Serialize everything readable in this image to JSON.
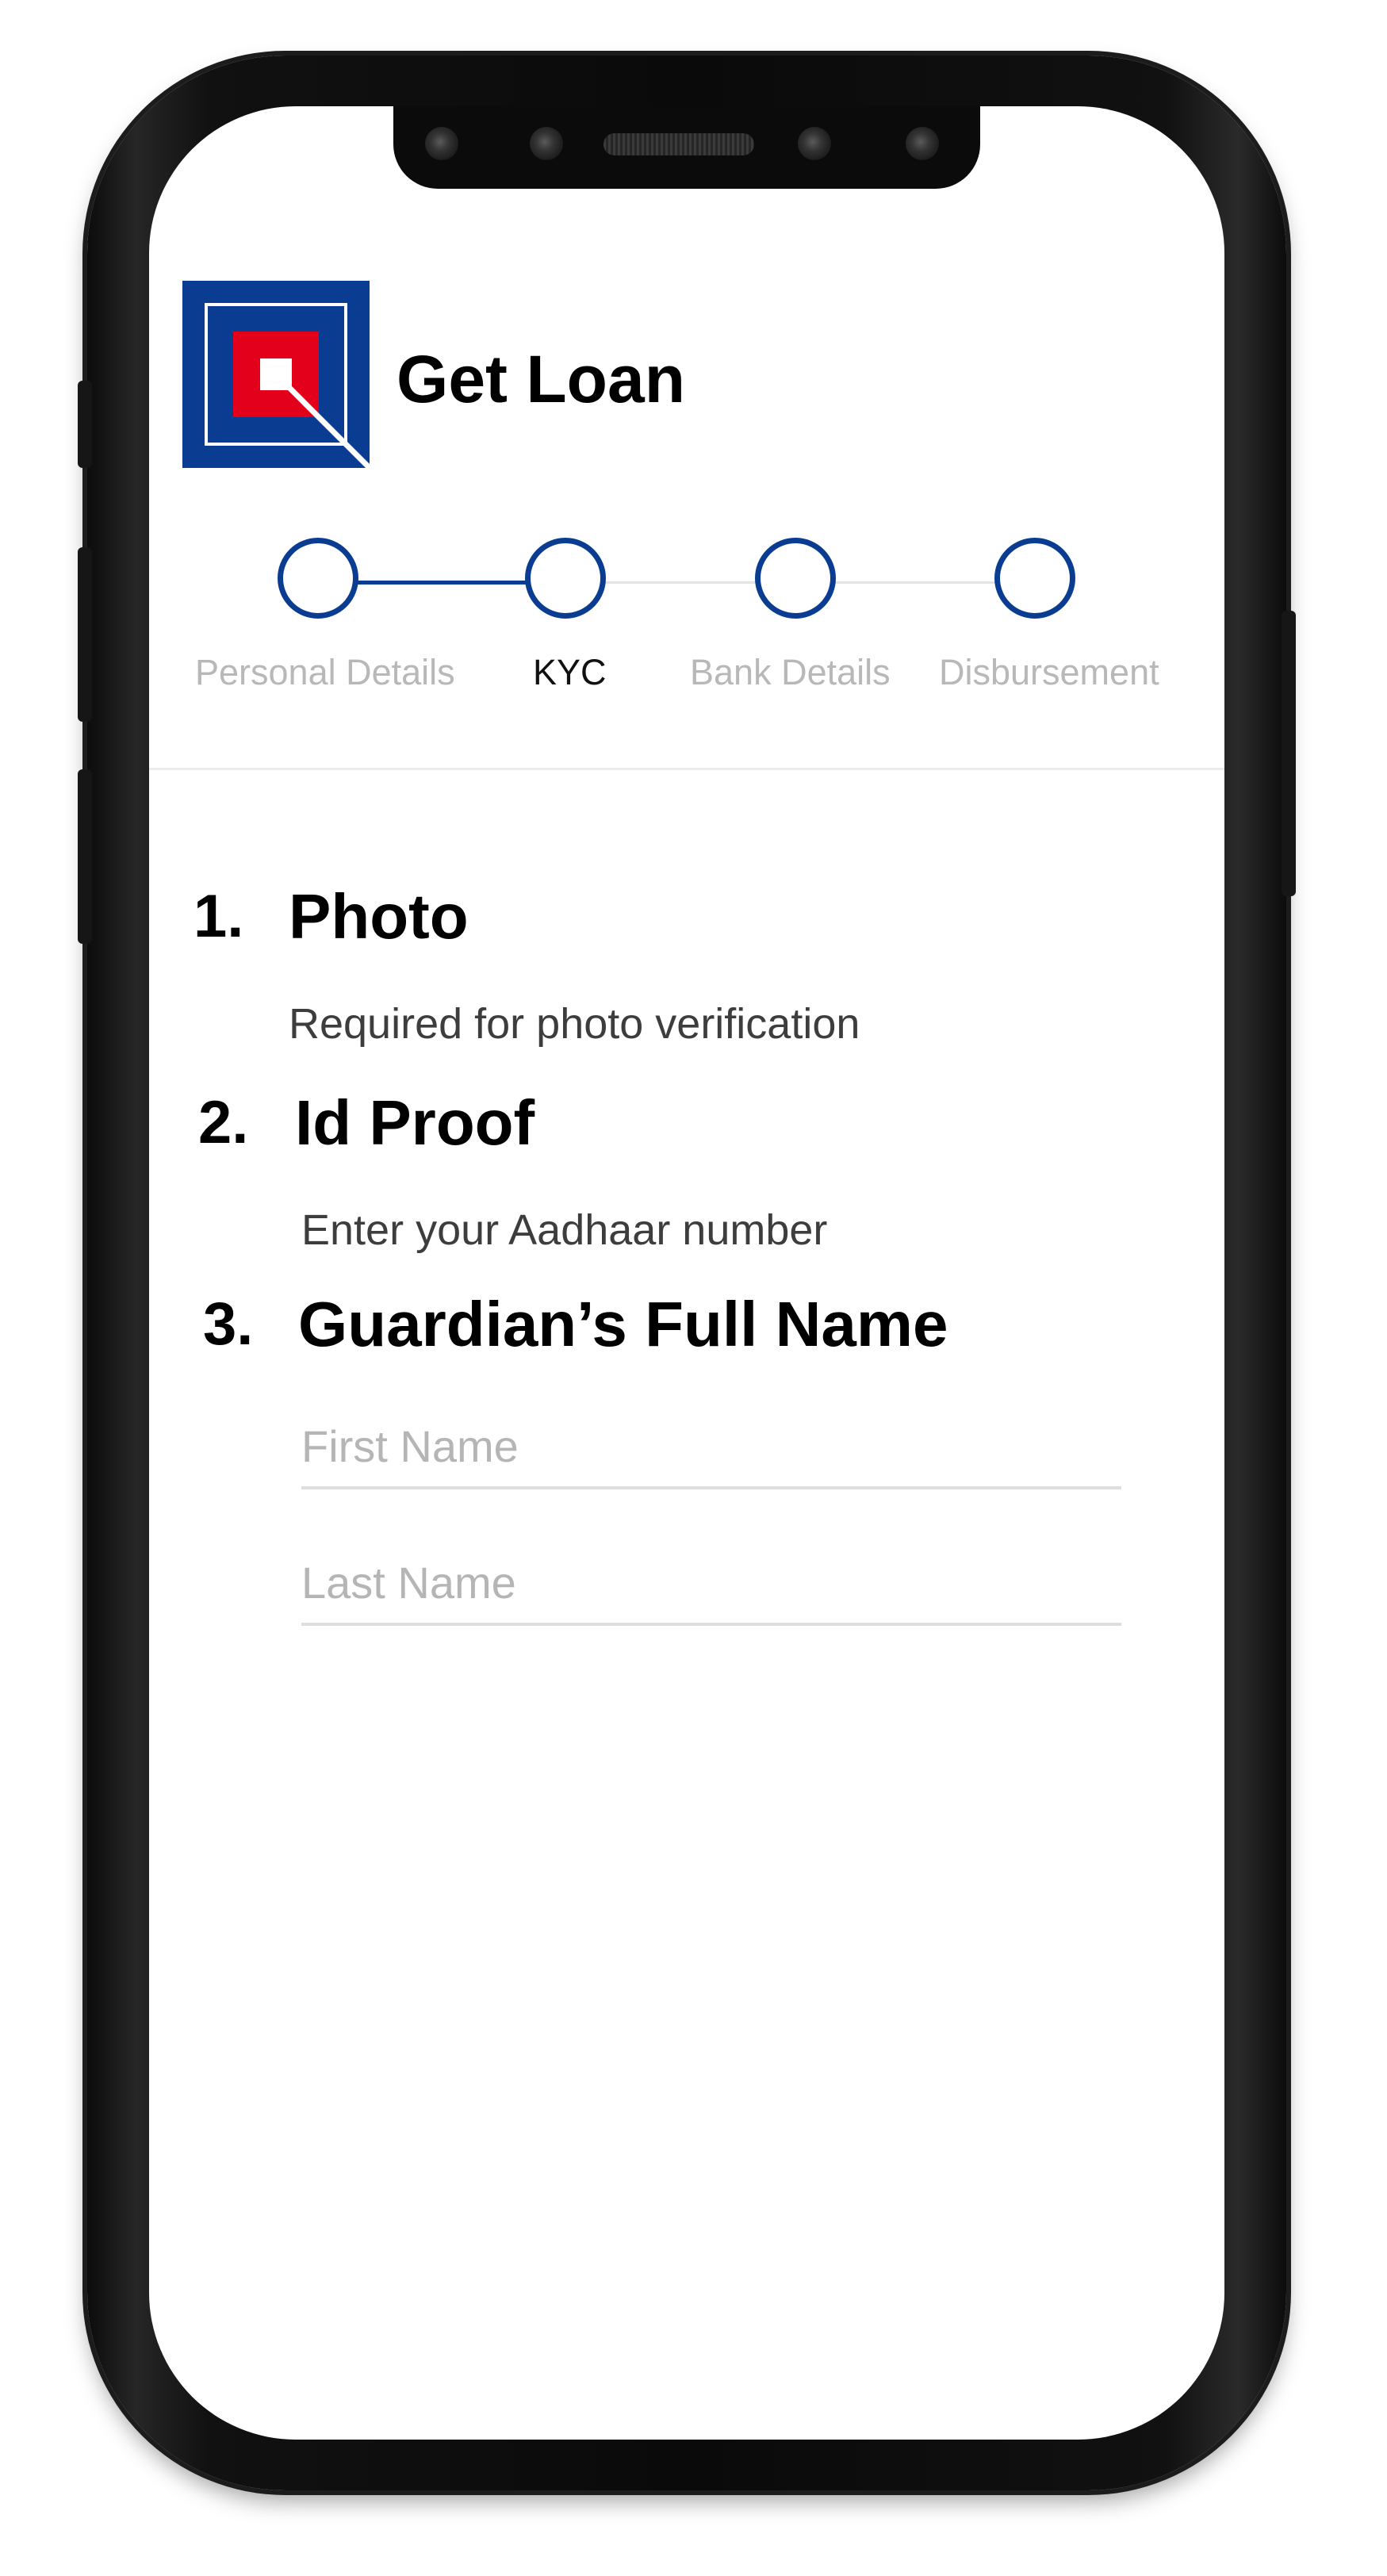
{
  "app": {
    "title": "Get Loan"
  },
  "colors": {
    "brand_blue": "#0a3d91",
    "logo_red": "#e2001a",
    "inactive_text": "#b8b8b8"
  },
  "stepper": {
    "steps": [
      {
        "label": "Personal Details",
        "state": "done"
      },
      {
        "label": "KYC",
        "state": "active"
      },
      {
        "label": "Bank Details",
        "state": "pending"
      },
      {
        "label": "Disbursement",
        "state": "pending"
      }
    ]
  },
  "kyc": {
    "sections": [
      {
        "number": "1.",
        "title": "Photo",
        "subtitle": "Required for photo verification"
      },
      {
        "number": "2.",
        "title": "Id Proof",
        "subtitle": "Enter your Aadhaar number"
      },
      {
        "number": "3.",
        "title": "Guardian’s Full Name"
      }
    ],
    "guardian": {
      "first_name_placeholder": "First Name",
      "last_name_placeholder": "Last Name"
    }
  }
}
